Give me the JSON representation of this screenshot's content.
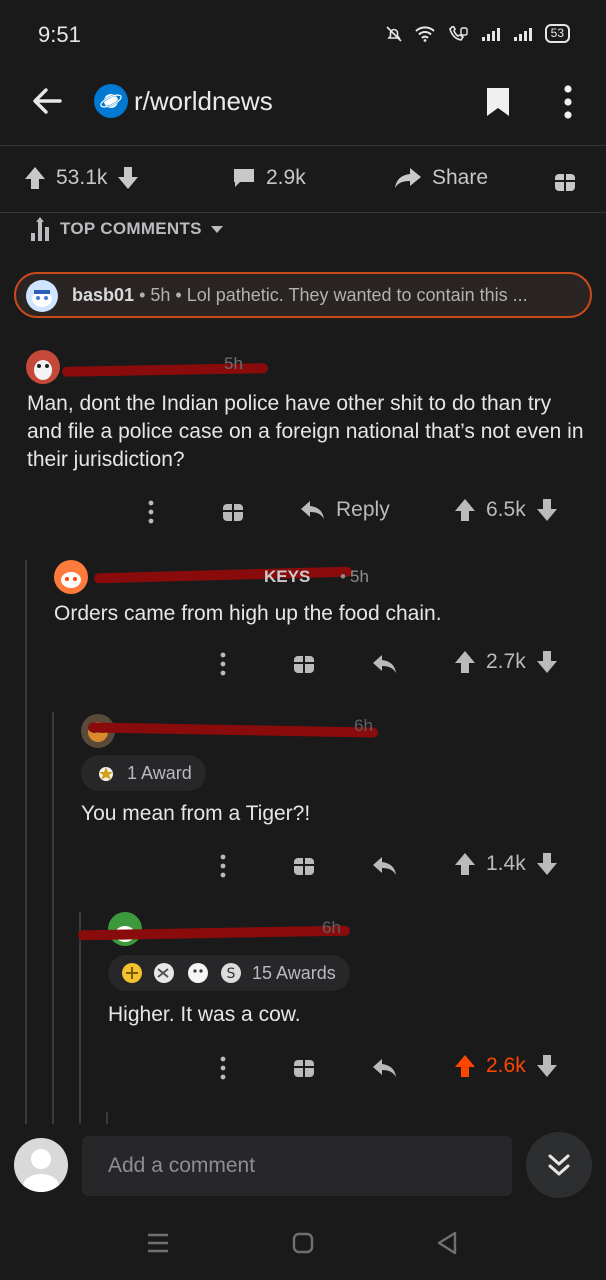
{
  "status_bar": {
    "time": "9:51",
    "battery": "53"
  },
  "header": {
    "subreddit": "r/worldnews"
  },
  "post_actions": {
    "upvotes": "53.1k",
    "comments": "2.9k",
    "share": "Share"
  },
  "sort": {
    "label": "TOP COMMENTS"
  },
  "highlighted_comment": {
    "user": "basb01",
    "age": "5h",
    "preview": "Lol pathetic. They wanted to contain this ..."
  },
  "comments": [
    {
      "age": "5h",
      "body": "Man, dont the Indian police have other shit to do than try and file a police case on a foreign national that’s not even in their jurisdiction?",
      "reply_label": "Reply",
      "score": "6.5k"
    },
    {
      "username_visible": "KEYS",
      "age": "5h",
      "body": "Orders came from high up the food chain.",
      "score": "2.7k"
    },
    {
      "age": "6h",
      "awards": "1 Award",
      "body": "You mean from a Tiger?!",
      "score": "1.4k"
    },
    {
      "age": "6h",
      "awards": "15 Awards",
      "body": "Higher. It was a cow.",
      "score": "2.6k"
    }
  ],
  "composer": {
    "placeholder": "Add a comment"
  },
  "colors": {
    "upvote_active": "#ff4500",
    "accent": "#0079d3",
    "highlight_border": "#c94a1a"
  }
}
